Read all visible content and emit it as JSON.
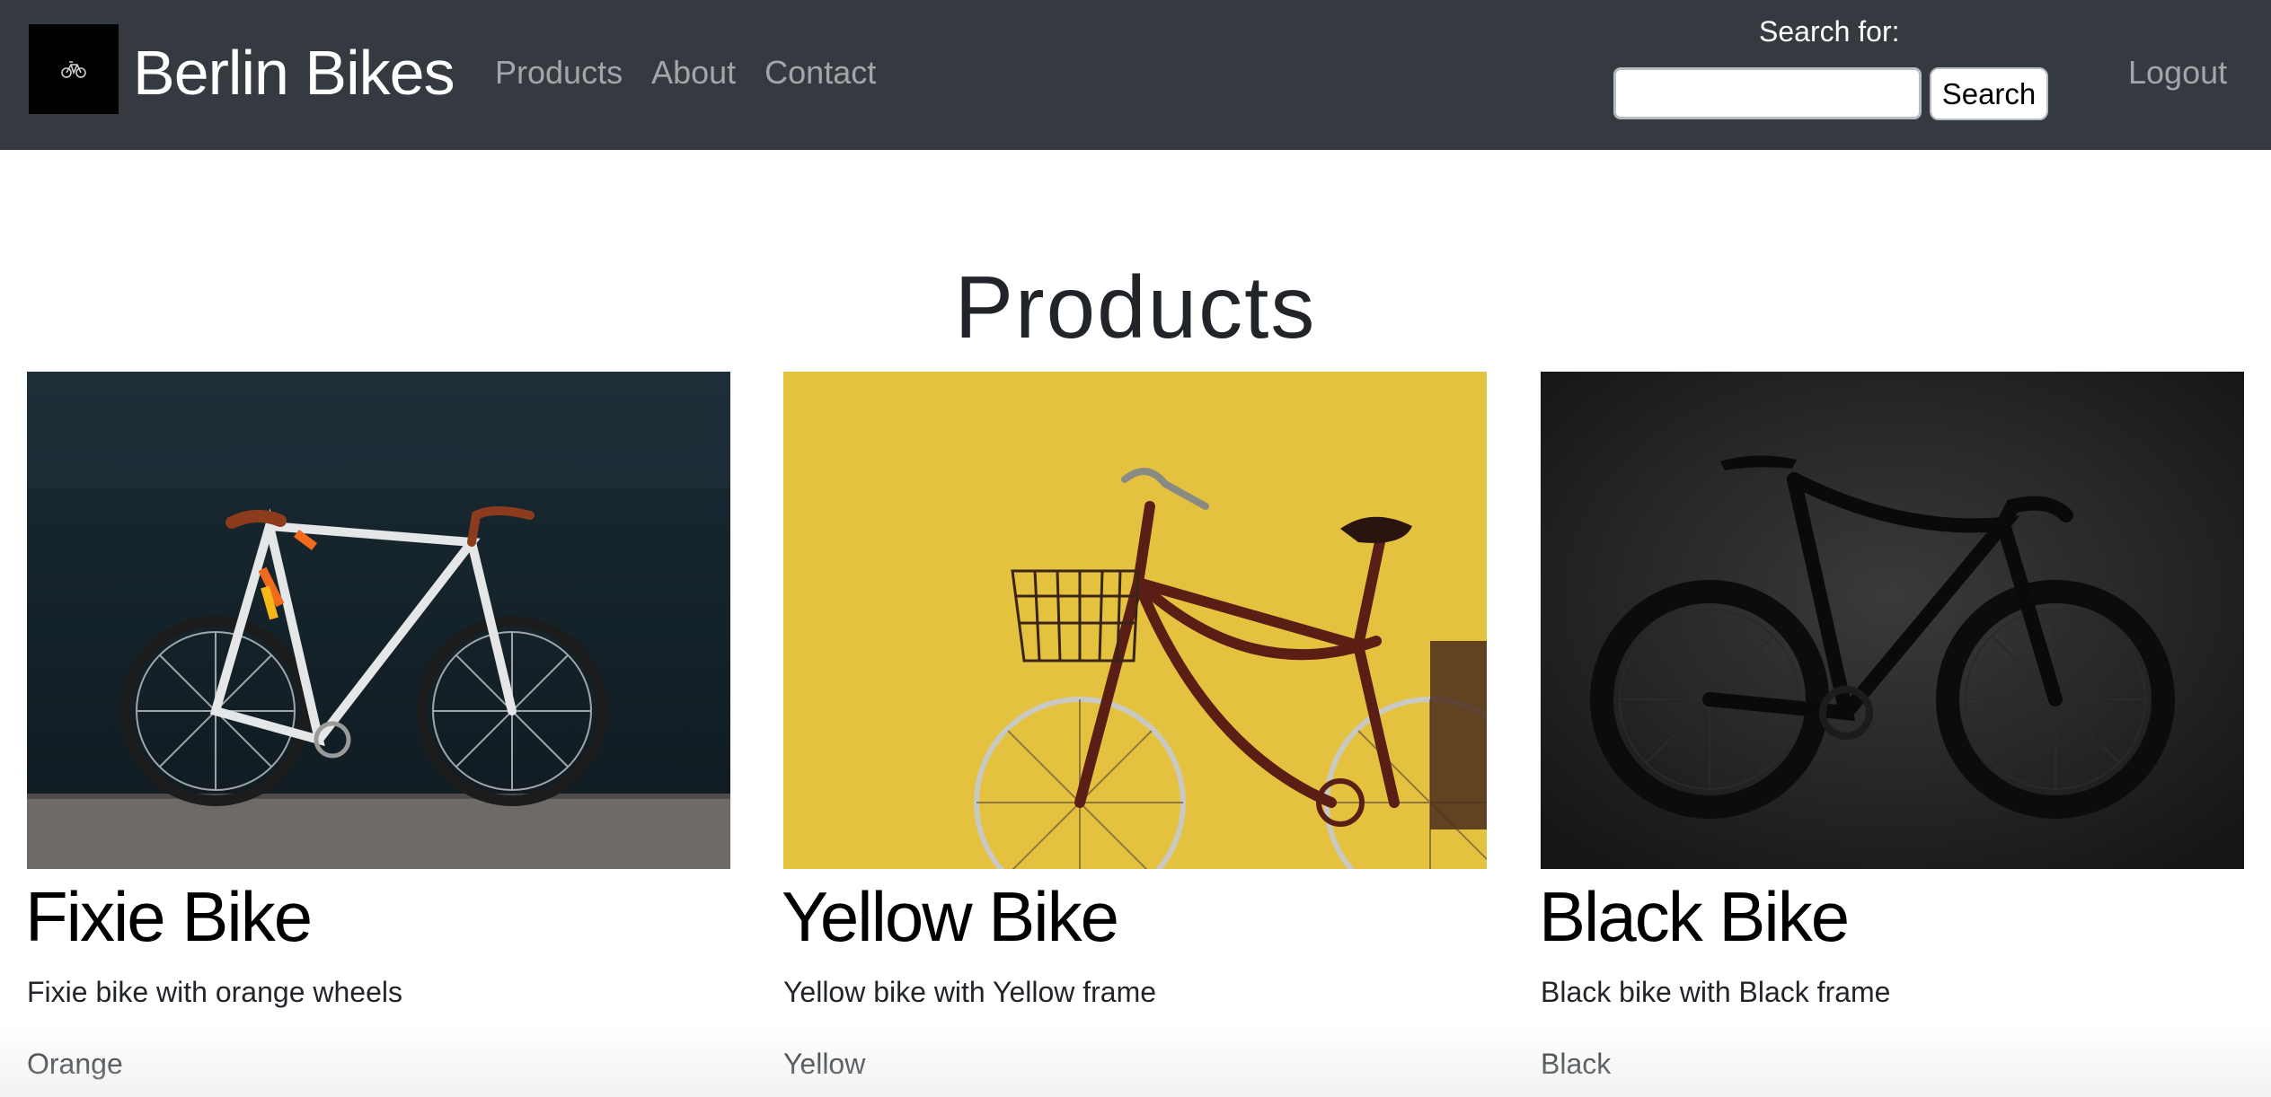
{
  "navbar": {
    "brand": "Berlin Bikes",
    "logo_icon": "bicycle-icon",
    "links": [
      {
        "label": "Products"
      },
      {
        "label": "About"
      },
      {
        "label": "Contact"
      }
    ],
    "search_label": "Search for:",
    "search_value": "",
    "search_button": "Search",
    "logout": "Logout",
    "colors": {
      "background": "#343a40",
      "link": "#a1a4a7",
      "text": "#ffffff"
    }
  },
  "main": {
    "title": "Products",
    "products": [
      {
        "name": "Fixie Bike",
        "description": "Fixie bike with orange wheels",
        "color": "Orange",
        "image": "white-fixie-bike-on-dark-wall"
      },
      {
        "name": "Yellow Bike",
        "description": "Yellow bike with Yellow frame",
        "color": "Yellow",
        "image": "red-city-bike-with-basket-on-yellow-wall"
      },
      {
        "name": "Black Bike",
        "description": "Black bike with Black frame",
        "color": "Black",
        "image": "black-road-bike-on-dark-background"
      }
    ]
  }
}
